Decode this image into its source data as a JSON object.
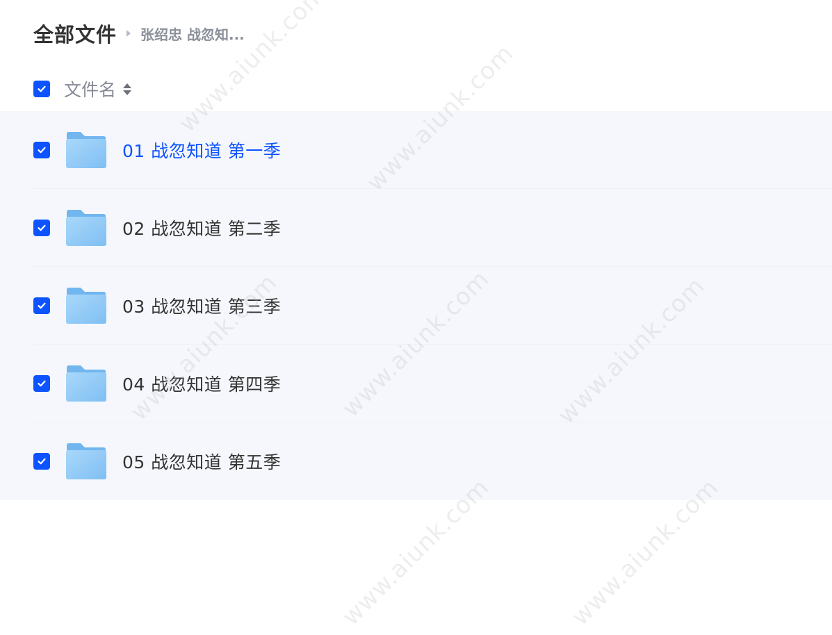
{
  "breadcrumb": {
    "root": "全部文件",
    "current": "张绍忠 战忽知..."
  },
  "header": {
    "column_label": "文件名"
  },
  "files": [
    {
      "name": "01 战忽知道 第一季",
      "type": "folder",
      "active": true
    },
    {
      "name": "02 战忽知道 第二季",
      "type": "folder",
      "active": false
    },
    {
      "name": "03 战忽知道 第三季",
      "type": "folder",
      "active": false
    },
    {
      "name": "04 战忽知道 第四季",
      "type": "folder",
      "active": false
    },
    {
      "name": "05 战忽知道 第五季",
      "type": "folder",
      "active": false
    }
  ],
  "watermark": "www.aiunk.com",
  "colors": {
    "accent": "#0d53ff",
    "row_bg": "#f5f7fc",
    "folder": "#8cc8f5"
  },
  "icons": {
    "checkbox": "checkbox-checked-icon",
    "folder": "folder-icon",
    "sort": "sort-icon",
    "separator": "caret-right-icon"
  }
}
